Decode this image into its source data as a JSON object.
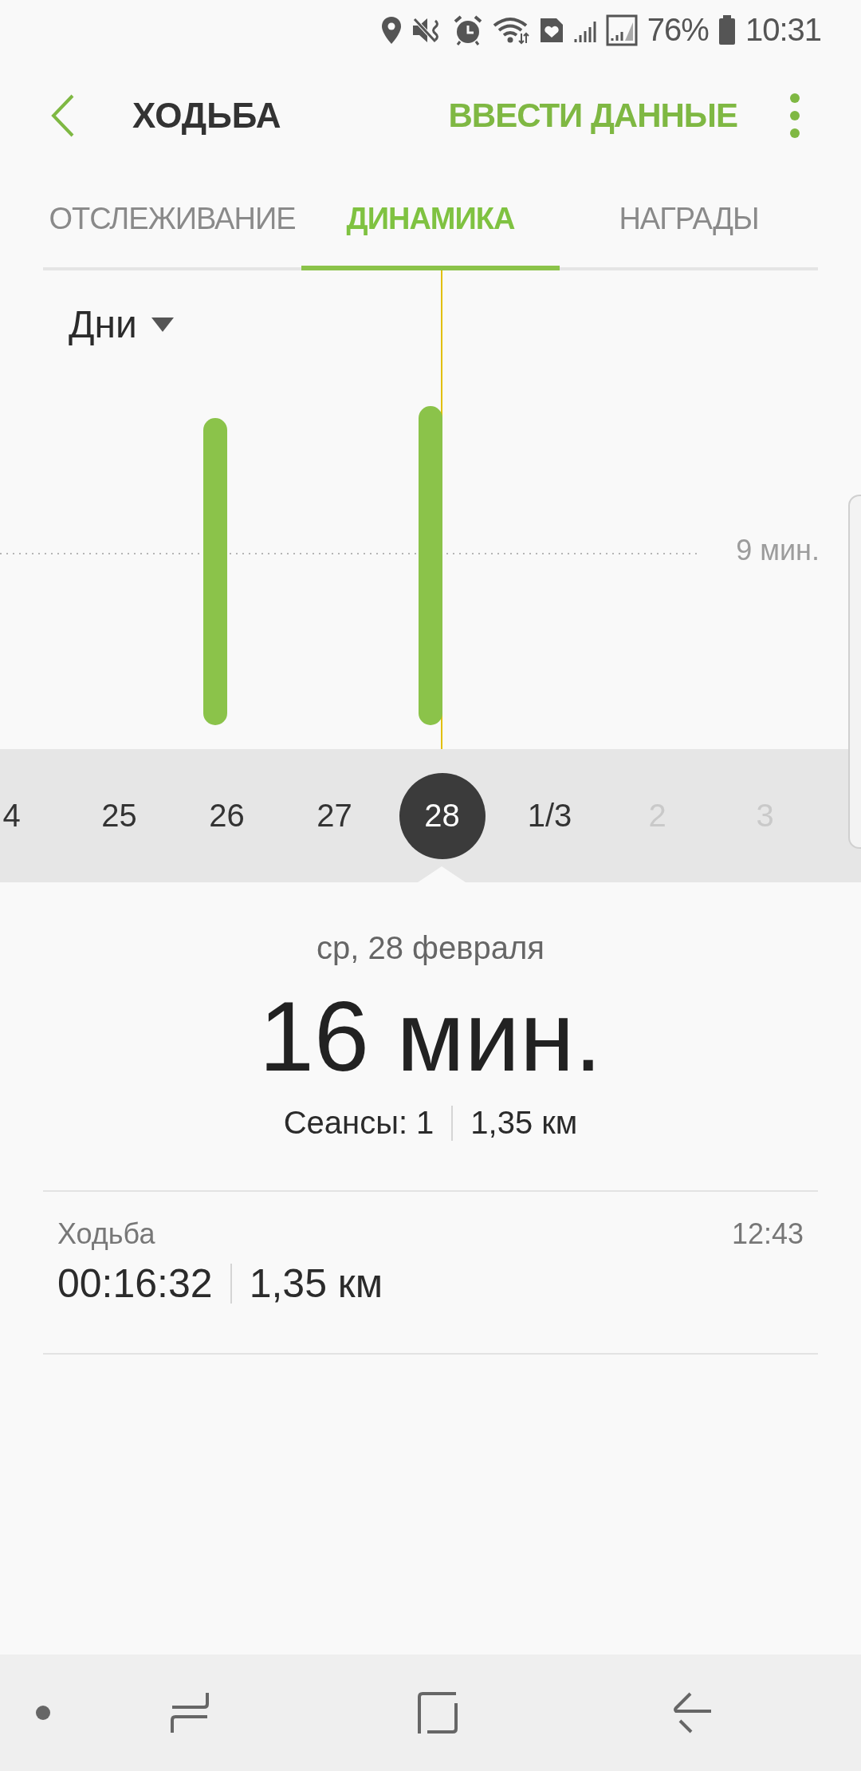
{
  "status_bar": {
    "battery": "76%",
    "time": "10:31"
  },
  "header": {
    "title": "ХОДЬБА",
    "action": "ВВЕСТИ ДАННЫЕ"
  },
  "tabs": [
    {
      "label": "ОТСЛЕЖИВАНИЕ",
      "selected": false
    },
    {
      "label": "ДИНАМИКА",
      "selected": true
    },
    {
      "label": "НАГРАДЫ",
      "selected": false
    }
  ],
  "chart": {
    "period": "Дни",
    "reference_label": "9 мин."
  },
  "days": [
    {
      "label": "4",
      "selected": false,
      "disabled": false
    },
    {
      "label": "25",
      "selected": false,
      "disabled": false
    },
    {
      "label": "26",
      "selected": false,
      "disabled": false
    },
    {
      "label": "27",
      "selected": false,
      "disabled": false
    },
    {
      "label": "28",
      "selected": true,
      "disabled": false
    },
    {
      "label": "1/3",
      "selected": false,
      "disabled": false
    },
    {
      "label": "2",
      "selected": false,
      "disabled": true
    },
    {
      "label": "3",
      "selected": false,
      "disabled": true
    }
  ],
  "summary": {
    "date": "ср, 28 февраля",
    "value": "16 мин.",
    "sessions": "Сеансы: 1",
    "distance": "1,35 км"
  },
  "records": [
    {
      "name": "Ходьба",
      "time": "12:43",
      "duration": "00:16:32",
      "distance": "1,35 км"
    }
  ]
}
